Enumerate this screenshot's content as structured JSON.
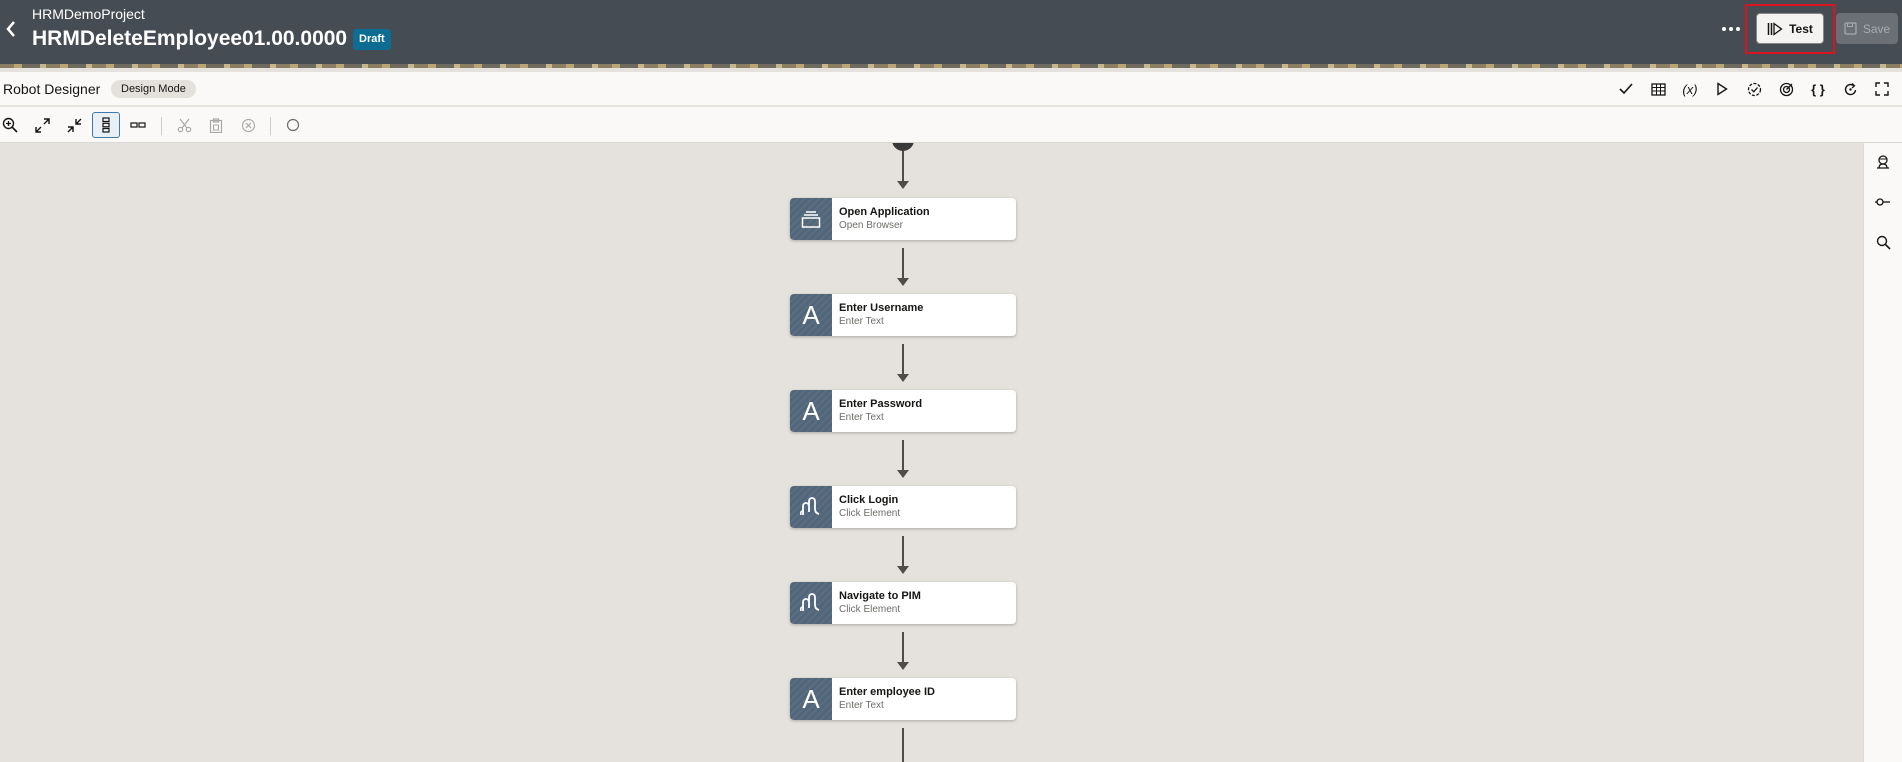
{
  "header": {
    "project_name": "HRMDemoProject",
    "robot_name": "HRMDeleteEmployee",
    "version": "01.00.0000",
    "status_badge": "Draft",
    "test_label": "Test",
    "save_label": "Save",
    "highlight_color": "#d9141f"
  },
  "designer": {
    "title": "Robot Designer",
    "mode": "Design Mode",
    "right_tools": [
      "validate-icon",
      "table-icon",
      "variables-icon",
      "run-icon",
      "check-circle-icon",
      "target-icon",
      "json-braces-icon",
      "reload-icon",
      "fullscreen-icon"
    ],
    "variables_text": "(x)",
    "json_text": "{ }"
  },
  "toolbar": {
    "tools": [
      "zoom-in-icon",
      "expand-icon",
      "collapse-icon",
      "vertical-layout-icon",
      "horizontal-layout-icon",
      "cut-icon",
      "paste-icon",
      "delete-icon",
      "circle-icon"
    ]
  },
  "flow": {
    "nodes": [
      {
        "title": "Open Application",
        "subtitle": "Open Browser",
        "icon": "application-icon"
      },
      {
        "title": "Enter Username",
        "subtitle": "Enter Text",
        "icon": "text-a-icon",
        "glyph": "A"
      },
      {
        "title": "Enter Password",
        "subtitle": "Enter Text",
        "icon": "text-a-icon",
        "glyph": "A"
      },
      {
        "title": "Click Login",
        "subtitle": "Click Element",
        "icon": "click-hand-icon"
      },
      {
        "title": "Navigate to PIM",
        "subtitle": "Click Element",
        "icon": "click-hand-icon"
      },
      {
        "title": "Enter employee ID",
        "subtitle": "Enter Text",
        "icon": "text-a-icon",
        "glyph": "A"
      }
    ]
  },
  "side_panel": {
    "tools": [
      "robot-agent-icon",
      "connection-icon",
      "search-icon"
    ]
  },
  "colors": {
    "header_bg": "#464c53",
    "badge_bg": "#0d6c92",
    "node_icon_bg": "#52667a",
    "canvas_bg": "#e5e2dd"
  }
}
